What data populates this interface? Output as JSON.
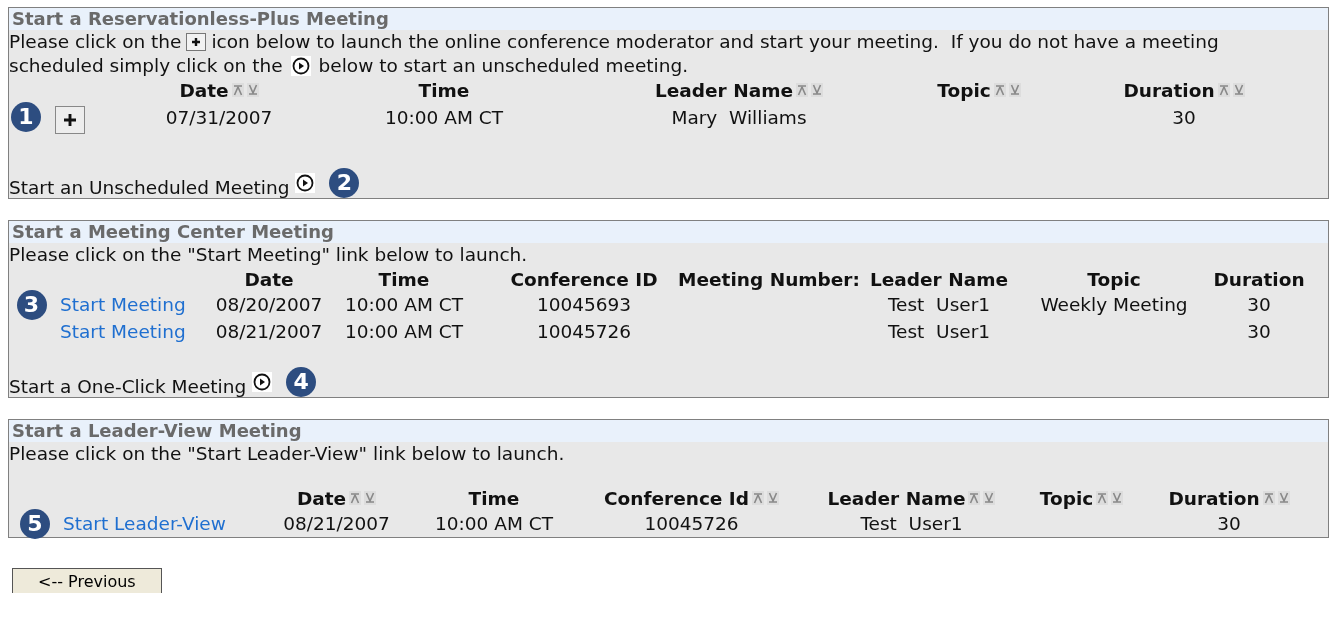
{
  "sections": [
    {
      "title": "Start a Reservationless-Plus Meeting",
      "intro": [
        [
          {
            "kind": "text",
            "text": "Please click on the"
          },
          {
            "kind": "add"
          },
          {
            "kind": "text",
            "text": "icon below to launch the online conference moderator and start your meeting.  If you do not have a meeting"
          }
        ],
        [
          {
            "kind": "text",
            "text": "scheduled simply click on the"
          },
          {
            "kind": "play"
          },
          {
            "kind": "text",
            "text": "below to start an unscheduled meeting."
          }
        ]
      ],
      "columns": [
        {
          "label": "Date",
          "sortable": true
        },
        {
          "label": "Time",
          "sortable": false
        },
        {
          "label": "Leader Name",
          "sortable": true
        },
        {
          "label": "Topic",
          "sortable": true
        },
        {
          "label": "Duration",
          "sortable": true
        }
      ],
      "rows": [
        {
          "callout": "1",
          "action": {
            "kind": "add"
          },
          "cells": [
            "07/31/2007",
            "10:00 AM CT",
            "Mary  Williams",
            null,
            "30"
          ]
        }
      ],
      "footer": {
        "label": "Start an Unscheduled Meeting",
        "callout": "2"
      }
    },
    {
      "title": "Start a Meeting Center Meeting",
      "intro": [
        [
          {
            "kind": "text",
            "text": "Please click on the \"Start Meeting\" link below to launch."
          }
        ]
      ],
      "columns": [
        {
          "label": "Date",
          "sortable": false
        },
        {
          "label": "Time",
          "sortable": false
        },
        {
          "label": "Conference ID",
          "sortable": false
        },
        {
          "label": "Meeting Number:",
          "sortable": false
        },
        {
          "label": "Leader Name",
          "sortable": false
        },
        {
          "label": "Topic",
          "sortable": false
        },
        {
          "label": "Duration",
          "sortable": false
        }
      ],
      "rows": [
        {
          "callout": "3",
          "action": {
            "kind": "link",
            "label": "Start Meeting"
          },
          "cells": [
            "08/20/2007",
            "10:00 AM CT",
            "10045693",
            null,
            "Test  User1",
            "Weekly Meeting",
            "30"
          ]
        },
        {
          "action": {
            "kind": "link",
            "label": "Start Meeting"
          },
          "cells": [
            "08/21/2007",
            "10:00 AM CT",
            "10045726",
            null,
            "Test  User1",
            null,
            "30"
          ]
        }
      ],
      "footer": {
        "label": "Start a One-Click Meeting",
        "callout": "4"
      }
    },
    {
      "title": "Start a Leader-View Meeting",
      "intro": [
        [
          {
            "kind": "text",
            "text": "Please click on the \"Start Leader-View\" link below to launch."
          }
        ]
      ],
      "columns": [
        {
          "label": "Date",
          "sortable": true
        },
        {
          "label": "Time",
          "sortable": false
        },
        {
          "label": "Conference Id",
          "sortable": true
        },
        {
          "label": "Leader Name",
          "sortable": true
        },
        {
          "label": "Topic",
          "sortable": true
        },
        {
          "label": "Duration",
          "sortable": true
        }
      ],
      "rows": [
        {
          "callout": "5",
          "action": {
            "kind": "link",
            "label": "Start Leader-View"
          },
          "cells": [
            "08/21/2007",
            "10:00 AM CT",
            "10045726",
            "Test  User1",
            null,
            "30"
          ]
        }
      ]
    }
  ],
  "previous_button": "<-- Previous"
}
